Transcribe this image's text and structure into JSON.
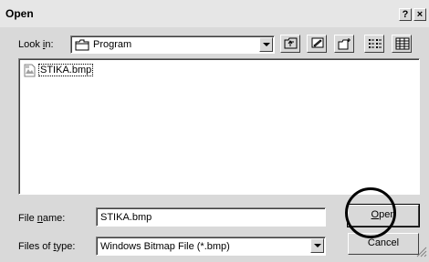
{
  "window": {
    "title": "Open",
    "help_label": "?",
    "close_label": "×"
  },
  "lookin": {
    "label_pre": "Look ",
    "label_key": "i",
    "label_post": "n:",
    "value": "Program"
  },
  "toolbar": {
    "icons": [
      "up-folder-icon",
      "desktop-icon",
      "new-folder-icon",
      "list-view-icon",
      "details-view-icon"
    ]
  },
  "files": [
    {
      "name": "STIKA.bmp",
      "icon": "bitmap-file-icon"
    }
  ],
  "filename": {
    "label_pre": "File ",
    "label_key": "n",
    "label_post": "ame:",
    "value": "STIKA.bmp"
  },
  "filetype": {
    "label_pre": "Files of ",
    "label_key": "t",
    "label_post": "ype:",
    "value": "Windows Bitmap File (*.bmp)"
  },
  "buttons": {
    "open_key": "O",
    "open_rest": "pen",
    "cancel": "Cancel"
  }
}
